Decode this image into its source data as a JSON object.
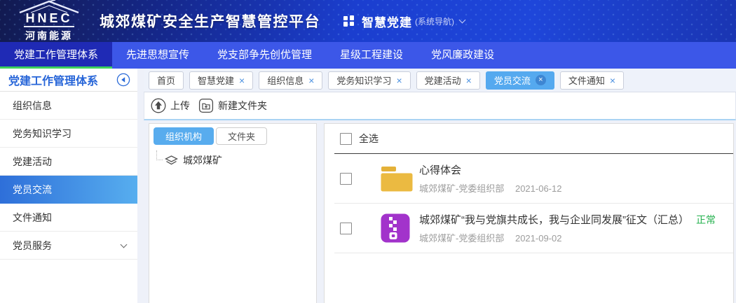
{
  "header": {
    "logo_acronym": "HNEC",
    "logo_name": "河南能源",
    "title": "城郊煤矿安全生产智慧管控平台",
    "switcher_label": "智慧党建",
    "switcher_suffix": "(系统导航)"
  },
  "top_nav": {
    "items": [
      {
        "label": "党建工作管理体系",
        "active": true
      },
      {
        "label": "先进思想宣传",
        "active": false
      },
      {
        "label": "党支部争先创优管理",
        "active": false
      },
      {
        "label": "星级工程建设",
        "active": false
      },
      {
        "label": "党风廉政建设",
        "active": false
      }
    ]
  },
  "sidebar": {
    "title": "党建工作管理体系",
    "items": [
      {
        "label": "组织信息",
        "active": false
      },
      {
        "label": "党务知识学习",
        "active": false
      },
      {
        "label": "党建活动",
        "active": false
      },
      {
        "label": "党员交流",
        "active": true
      },
      {
        "label": "文件通知",
        "active": false
      },
      {
        "label": "党员服务",
        "active": false,
        "expandable": true
      }
    ]
  },
  "tab_bar": {
    "tabs": [
      {
        "label": "首页",
        "closable": false,
        "active": false
      },
      {
        "label": "智慧党建",
        "closable": true,
        "active": false
      },
      {
        "label": "组织信息",
        "closable": true,
        "active": false
      },
      {
        "label": "党务知识学习",
        "closable": true,
        "active": false
      },
      {
        "label": "党建活动",
        "closable": true,
        "active": false
      },
      {
        "label": "党员交流",
        "closable": true,
        "active": true
      },
      {
        "label": "文件通知",
        "closable": true,
        "active": false
      }
    ]
  },
  "toolbar": {
    "upload_label": "上传",
    "new_folder_label": "新建文件夹"
  },
  "tree_panel": {
    "tabs": [
      {
        "label": "组织机构",
        "active": true
      },
      {
        "label": "文件夹",
        "active": false
      }
    ],
    "root_node": "城郊煤矿"
  },
  "file_list": {
    "select_all_label": "全选",
    "items": [
      {
        "icon": "folder-icon",
        "title": "心得体会",
        "source": "城郊煤矿-党委组织部",
        "date": "2021-06-12"
      },
      {
        "icon": "zip-icon",
        "title": "城郊煤矿“我与党旗共成长，我与企业同发展”征文（汇总）",
        "status": "正常",
        "source": "城郊煤矿-党委组织部",
        "date": "2021-09-02"
      }
    ]
  },
  "icons": {
    "close": "×"
  },
  "colors": {
    "header_blue": "#1c3fd2",
    "nav_blue": "#3c57e8",
    "nav_active_blue": "#1f2ab5",
    "active_green": "#3ed25c",
    "accent_light_blue": "#55a9ef",
    "sidebar_active_start": "#2e6fd9",
    "sidebar_active_end": "#57aeef",
    "toolbar_underline": "#a9d3f3",
    "folder_yellow": "#E9B83D",
    "zip_purple": "#A233CB",
    "status_green": "#23b14d"
  }
}
